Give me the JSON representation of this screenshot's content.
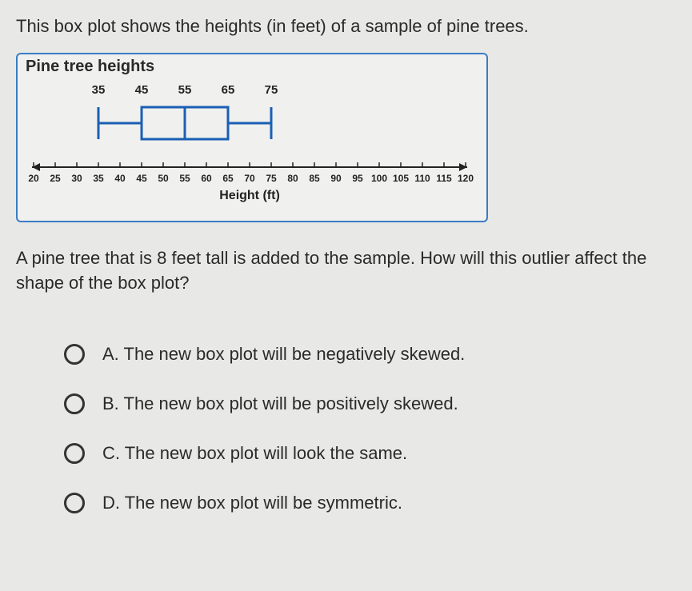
{
  "intro": "This box plot shows the heights (in feet) of a sample of pine trees.",
  "plot_title": "Pine tree heights",
  "chart_data": {
    "type": "boxplot",
    "title": "Pine tree heights",
    "xlabel": "Height (ft)",
    "axis_ticks": [
      20,
      25,
      30,
      35,
      40,
      45,
      50,
      55,
      60,
      65,
      70,
      75,
      80,
      85,
      90,
      95,
      100,
      105,
      110,
      115,
      120
    ],
    "value_labels": [
      35,
      45,
      55,
      65,
      75
    ],
    "five_number_summary": {
      "min": 35,
      "q1": 45,
      "median": 55,
      "q3": 65,
      "max": 75
    },
    "xlim": [
      20,
      120
    ]
  },
  "xlabel": "Height (ft)",
  "question": "A pine tree that is 8 feet tall is added to the sample. How will this outlier affect the shape of the box plot?",
  "choices": {
    "a": "A.  The new box plot will be negatively skewed.",
    "b": "B.  The new box plot will be positively skewed.",
    "c": "C.  The new box plot will look the same.",
    "d": "D.  The new box plot will be symmetric."
  }
}
